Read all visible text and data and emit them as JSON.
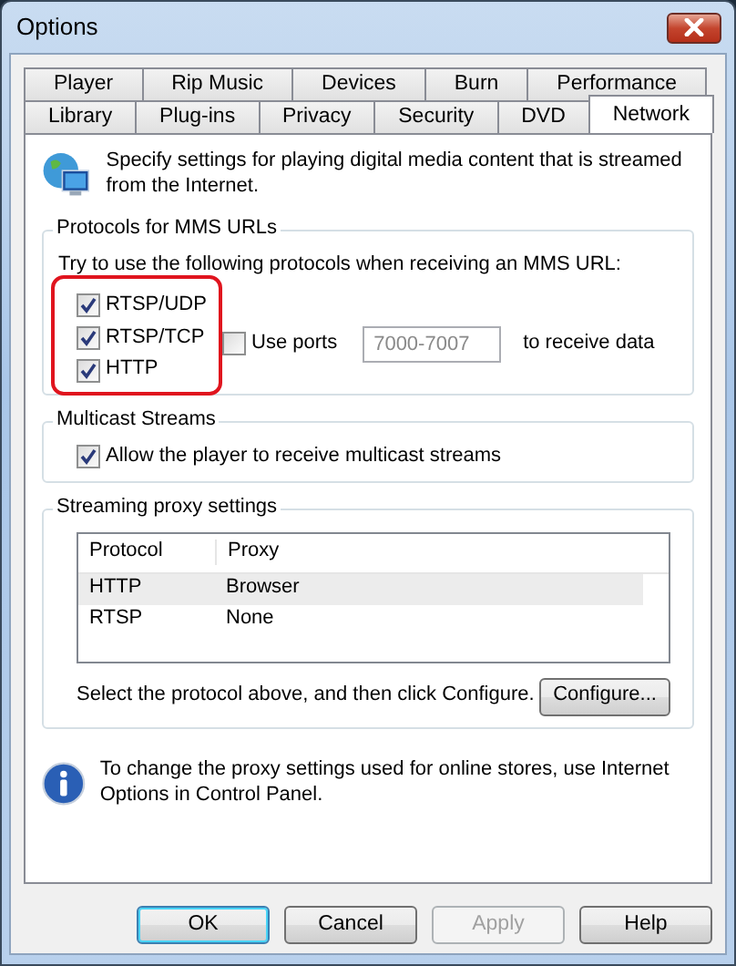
{
  "window": {
    "title": "Options"
  },
  "tab_rows": [
    [
      {
        "label": "Player",
        "selected": false
      },
      {
        "label": "Rip Music",
        "selected": false
      },
      {
        "label": "Devices",
        "selected": false
      },
      {
        "label": "Burn",
        "selected": false
      },
      {
        "label": "Performance",
        "selected": false
      }
    ],
    [
      {
        "label": "Library",
        "selected": false
      },
      {
        "label": "Plug-ins",
        "selected": false
      },
      {
        "label": "Privacy",
        "selected": false
      },
      {
        "label": "Security",
        "selected": false
      },
      {
        "label": "DVD",
        "selected": false
      },
      {
        "label": "Network",
        "selected": true
      }
    ]
  ],
  "intro": "Specify settings for playing digital media content that is streamed from the Internet.",
  "mms_group": {
    "title": "Protocols for MMS URLs",
    "instruction": "Try to use the following protocols when receiving an MMS URL:",
    "protocols": [
      {
        "label": "RTSP/UDP",
        "checked": true
      },
      {
        "label": "RTSP/TCP",
        "checked": true
      },
      {
        "label": "HTTP",
        "checked": true
      }
    ],
    "highlighted": true,
    "use_ports": {
      "label": "Use ports",
      "checked": false
    },
    "ports_field": {
      "value": "7000-7007",
      "disabled": true
    },
    "suffix": "to receive data"
  },
  "multicast_group": {
    "title": "Multicast Streams",
    "option": {
      "label": "Allow the player to receive multicast streams",
      "checked": true
    }
  },
  "proxy_group": {
    "title": "Streaming proxy settings",
    "columns": [
      "Protocol",
      "Proxy"
    ],
    "rows": [
      {
        "cells": [
          "HTTP",
          "Browser"
        ],
        "selected": true
      },
      {
        "cells": [
          "RTSP",
          "None"
        ],
        "selected": false
      }
    ],
    "hint": "Select the protocol above, and then click Configure.",
    "configure_button": "Configure..."
  },
  "info_note": "To change the proxy settings used for online stores, use Internet Options in Control Panel.",
  "buttons": [
    {
      "label": "OK",
      "default": true,
      "disabled": false
    },
    {
      "label": "Cancel",
      "default": false,
      "disabled": false
    },
    {
      "label": "Apply",
      "default": false,
      "disabled": true
    },
    {
      "label": "Help",
      "default": false,
      "disabled": false
    }
  ]
}
